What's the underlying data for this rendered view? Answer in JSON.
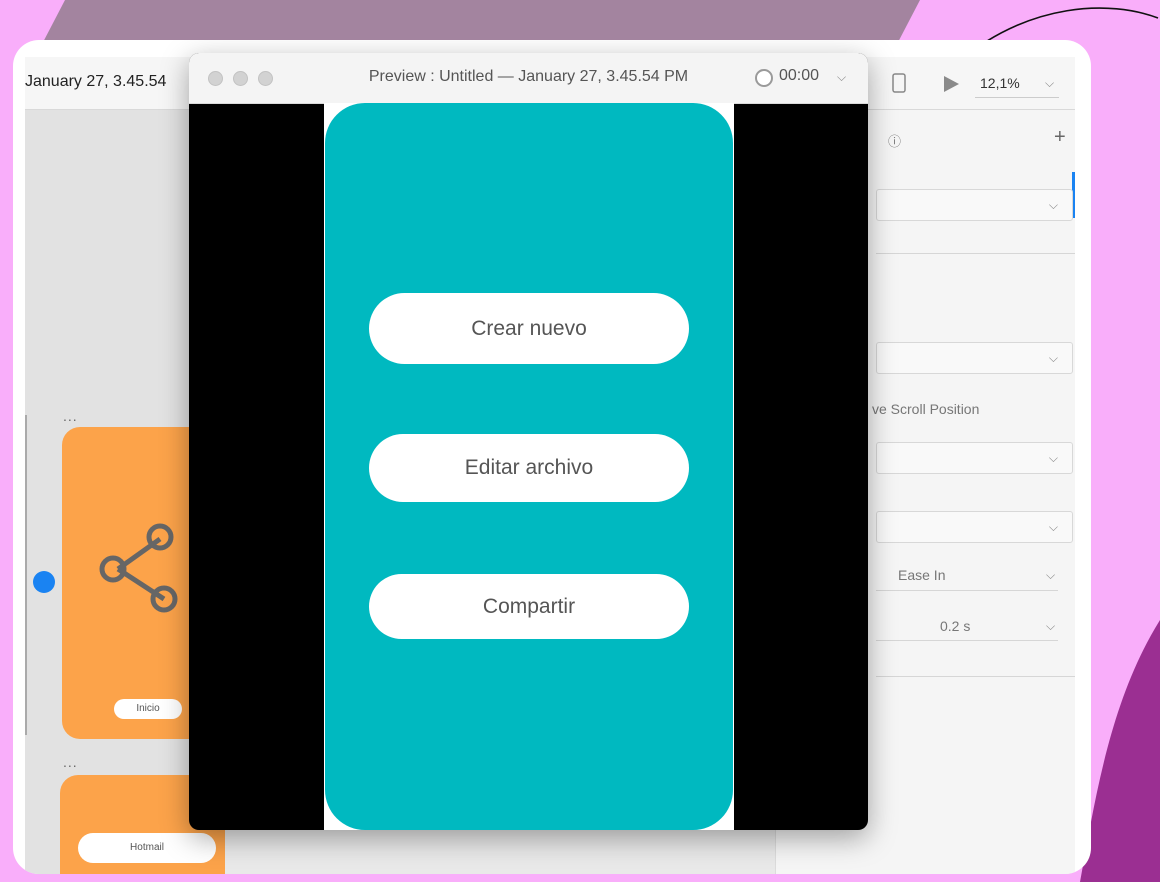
{
  "editor": {
    "doc_title": "January 27, 3.45.54",
    "zoom": "12,1%",
    "left_panel": {
      "artboards": [
        {
          "more": "...",
          "button_label": "Inicio"
        },
        {
          "more": "...",
          "button_label": "Hotmail"
        }
      ]
    },
    "right_panel": {
      "add": "+",
      "info": "ⓘ",
      "preserve_scroll": "ve Scroll Position",
      "easing": "Ease In",
      "duration": "0.2 s"
    }
  },
  "preview": {
    "title": "Preview : Untitled — January 27, 3.45.54 PM",
    "timer": "00:00",
    "buttons": [
      "Crear nuevo",
      "Editar archivo",
      "Compartir"
    ]
  },
  "colors": {
    "background": "#f9aefa",
    "phone_screen": "#00b9c0",
    "artboard": "#fca34a",
    "accent_purple": "#9b2f92"
  }
}
